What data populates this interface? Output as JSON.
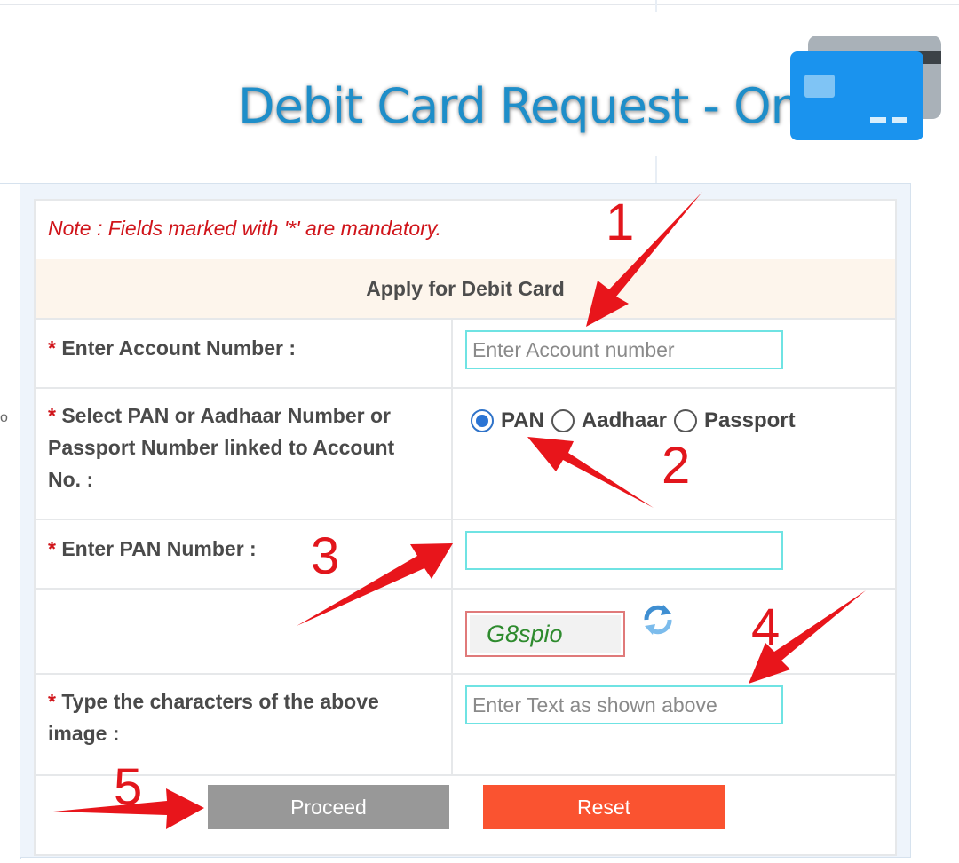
{
  "header": {
    "title": "Debit Card Request - Online",
    "icon": "credit-card-icon"
  },
  "form": {
    "note": "Note : Fields marked with '*' are mandatory.",
    "section_title": "Apply for Debit Card",
    "required_marker": "*",
    "account": {
      "label": " Enter Account Number :",
      "placeholder": "Enter Account number",
      "value": ""
    },
    "id_type": {
      "label": " Select PAN or Aadhaar Number or Passport Number linked to Account No. :",
      "options": [
        "PAN",
        "Aadhaar",
        "Passport"
      ],
      "selected": "PAN"
    },
    "pan": {
      "label": " Enter PAN Number :",
      "value": ""
    },
    "captcha": {
      "text": "G8spio",
      "refresh_icon": "refresh-icon"
    },
    "captcha_input": {
      "label": " Type the characters of the above image :",
      "placeholder": "Enter Text as shown above",
      "value": ""
    },
    "buttons": {
      "proceed": "Proceed",
      "reset": "Reset"
    }
  },
  "annotations": [
    "1",
    "2",
    "3",
    "4",
    "5"
  ],
  "colors": {
    "title_blue": "#1e8ec9",
    "required_red": "#d0141a",
    "input_border": "#6fe3e3",
    "proceed_gray": "#989898",
    "reset_orange": "#fa5330",
    "annotation_red": "#e2161c",
    "section_bg": "#fdf5ec"
  }
}
